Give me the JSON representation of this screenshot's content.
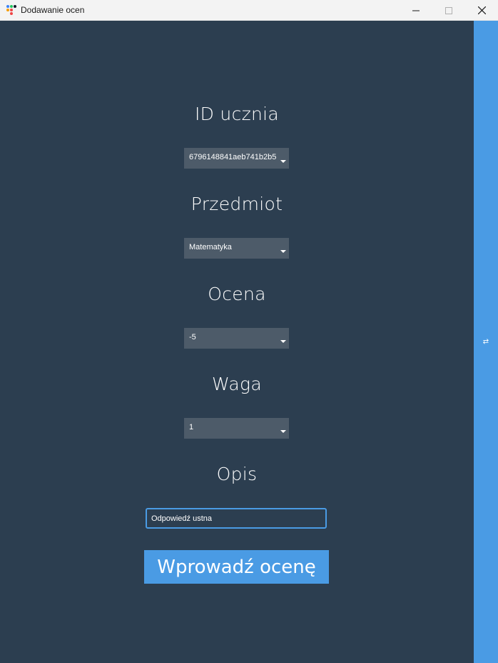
{
  "window": {
    "title": "Dodawanie ocen",
    "icon": "app-icon"
  },
  "form": {
    "student_id": {
      "label": "ID ucznia",
      "value": "6796148841aeb741b2b5"
    },
    "subject": {
      "label": "Przedmiot",
      "value": "Matematyka"
    },
    "grade": {
      "label": "Ocena",
      "value": "-5"
    },
    "weight": {
      "label": "Waga",
      "value": "1"
    },
    "description": {
      "label": "Opis",
      "value": "Odpowiedź ustna"
    },
    "submit_label": "Wprowadź ocenę"
  },
  "side_panel": {
    "toggle_glyph": "⇄"
  },
  "colors": {
    "background": "#2c3e50",
    "accent": "#4a9be4",
    "combo_bg": "#4d5b69"
  }
}
